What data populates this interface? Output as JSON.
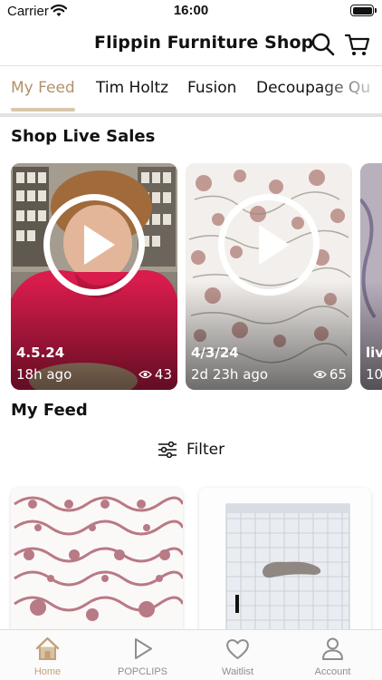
{
  "status_bar": {
    "carrier": "Carrier",
    "time": "16:00"
  },
  "header": {
    "title": "Flippin Furniture Shop",
    "search_icon": "search-icon",
    "cart_icon": "cart-icon"
  },
  "tabs": [
    {
      "label": "My Feed",
      "active": true
    },
    {
      "label": "Tim Holtz",
      "active": false
    },
    {
      "label": "Fusion",
      "active": false
    },
    {
      "label": "Decoupage Qu",
      "active": false
    }
  ],
  "live_sales": {
    "title": "Shop Live Sales",
    "cards": [
      {
        "date": "4.5.24",
        "time_ago": "18h ago",
        "views": "43"
      },
      {
        "date": "4/3/24",
        "time_ago": "2d 23h ago",
        "views": "65"
      },
      {
        "date": "live",
        "time_ago": "10"
      }
    ]
  },
  "feed": {
    "title": "My Feed",
    "filter_label": "Filter"
  },
  "tab_bar": {
    "items": [
      {
        "label": "Home",
        "icon": "home-icon",
        "active": true
      },
      {
        "label": "POPCLIPS",
        "icon": "play-icon",
        "active": false
      },
      {
        "label": "Waitlist",
        "icon": "heart-icon",
        "active": false
      },
      {
        "label": "Account",
        "icon": "person-icon",
        "active": false
      }
    ]
  },
  "colors": {
    "accent": "#c4a07a",
    "tab_active": "#b3916a",
    "underline": "#d9c7ad",
    "shirt": "#d81c4c",
    "floral": "#b87a84"
  }
}
